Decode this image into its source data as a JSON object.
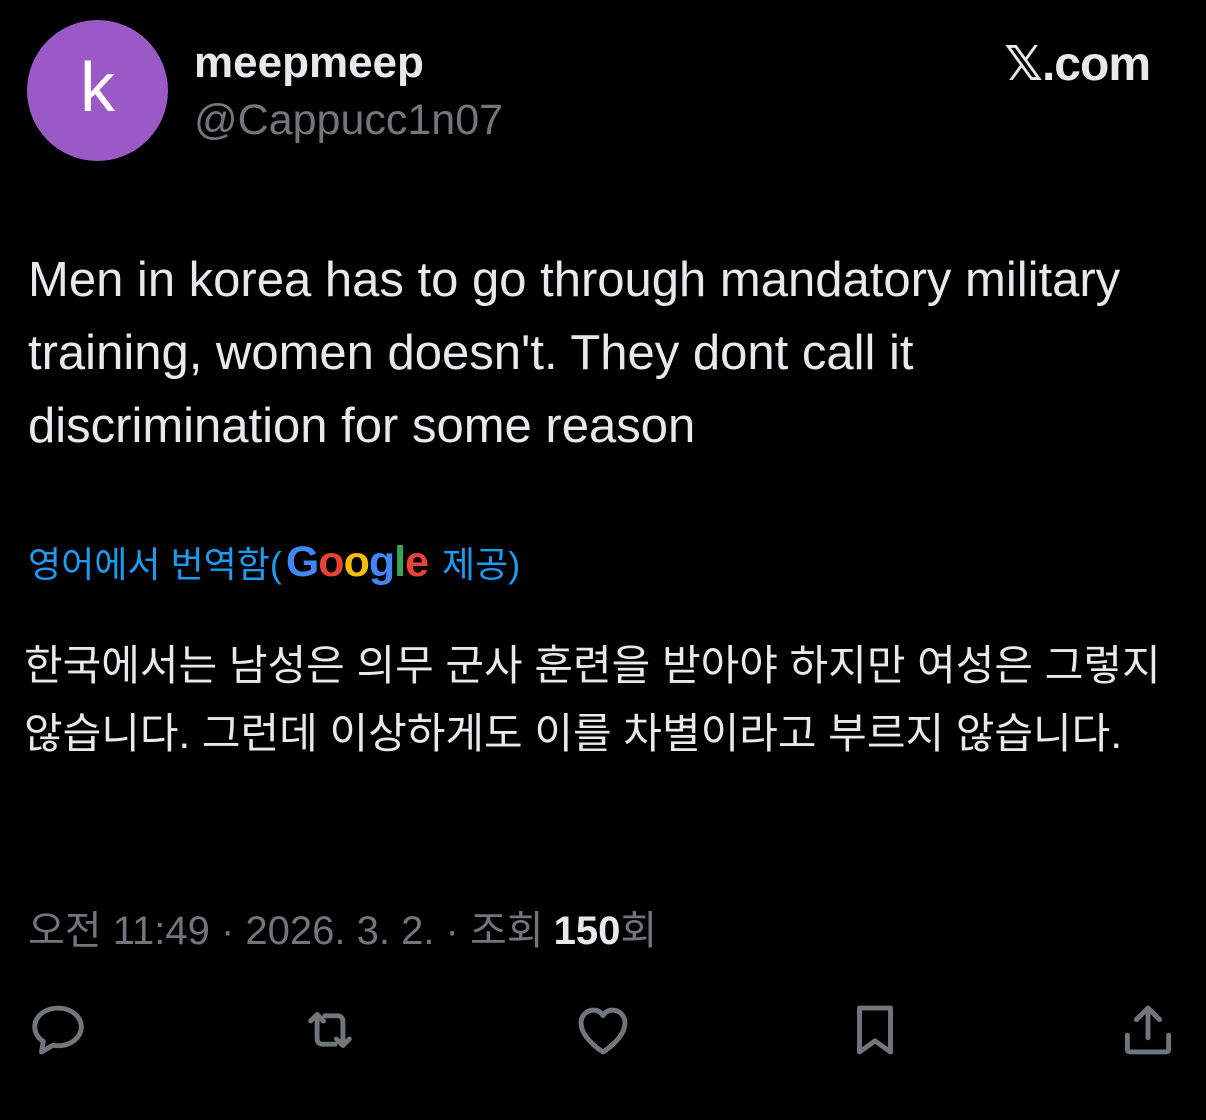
{
  "author": {
    "avatar_letter": "k",
    "avatar_color": "#9b59c6",
    "display_name": "meepmeep",
    "handle": "@Cappucc1n07"
  },
  "brand": "𝕏.com",
  "tweet": {
    "text": "Men in korea has to go through mandatory military training, women doesn't. They dont call it discrimination for some reason"
  },
  "translation": {
    "label": "영어에서 번역함(",
    "provider": "Google",
    "suffix": "제공)",
    "text": "한국에서는 남성은 의무 군사 훈련을 받아야 하지만 여성은 그렇지 않습니다. 그런데 이상하게도 이를 차별이라고 부르지 않습니다."
  },
  "meta": {
    "time_date": "오전 11:49 · 2026. 3. 2. · 조회",
    "views": "150",
    "views_suffix": "회"
  },
  "actions": {
    "reply_icon": "reply-icon",
    "retweet_icon": "retweet-icon",
    "like_icon": "heart-icon",
    "bookmark_icon": "bookmark-icon",
    "share_icon": "share-icon"
  },
  "colors": {
    "background": "#000000",
    "text": "#e7e9ea",
    "secondary": "#71767b",
    "link": "#1d9bf0"
  }
}
